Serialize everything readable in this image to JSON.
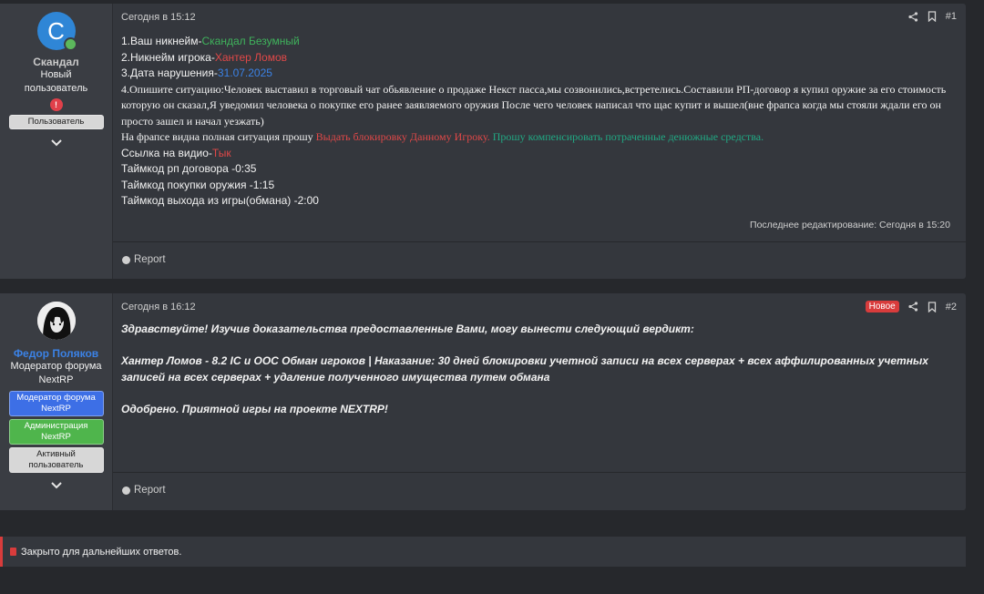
{
  "posts": [
    {
      "user": {
        "avatar_letter": "C",
        "name": "Скандал",
        "title": "Новый пользователь",
        "badges": [
          "Пользователь"
        ]
      },
      "date": "Сегодня в 15:12",
      "number": "#1",
      "lines": {
        "l1_label": "1.Ваш никнейм-",
        "l1_value": "Скандал Безумный",
        "l2_label": "2.Никнейм игрока-",
        "l2_value": "Хантер Ломов",
        "l3_label": "3.Дата нарушения-",
        "l3_value": "31.07.2025",
        "l4": "4.Опишите ситуацию:Человек выставил в торговый чат обьявление о продаже Некст пасса,мы созвонились,встретелись.Составили РП-договор я купил оружие за его стоимость которую он сказал,Я уведомил человека о покупке его ранее заявляемого оружия После чего человек написал что щас купит и вышел(вне фрапса когда мы стояли ждали его он просто зашел и начал уезжать)",
        "l5_a": "На фрапсе видна полная ситуация прошу ",
        "l5_b": "Выдать блокировку Данному Игроку.",
        "l5_c": " Прошу компенсировать потраченные денюжные средства.",
        "l6_label": "Ссылка на видио-",
        "l6_value": "Тык",
        "l7": "Таймкод рп договора -0:35",
        "l8": "Таймкод покупки оружия -1:15",
        "l9": "Таймкод выхода из игры(обмана) -2:00"
      },
      "edited": "Последнее редактирование: Сегодня в 15:20",
      "report": "Report"
    },
    {
      "user": {
        "name": "Федор Поляков",
        "title": "Модератор форума NextRP",
        "badges": [
          "Модератор форума NextRP",
          "Администрация NextRP",
          "Активный пользователь"
        ]
      },
      "date": "Сегодня в 16:12",
      "new_label": "Новое",
      "number": "#2",
      "paragraphs": [
        "Здравствуйте! Изучив доказательства предоставленные Вами, могу вынести следующий вердикт:",
        "Хантер Ломов - 8.2 IC и OOC Обман игроков | Наказание: 30 дней блокировки учетной записи на всех серверах + всех аффилированных учетных записей на всех серверах + удаление полученного имущества путем обмана",
        "Одобрено. Приятной игры на проекте NEXTRP!"
      ],
      "report": "Report"
    }
  ],
  "closed_notice": "Закрыто для дальнейших ответов.",
  "colors": {
    "accent": "#3b82e6",
    "green": "#3fb35c",
    "red": "#e04848",
    "teal": "#21a984",
    "new_badge": "#d83c3c"
  }
}
